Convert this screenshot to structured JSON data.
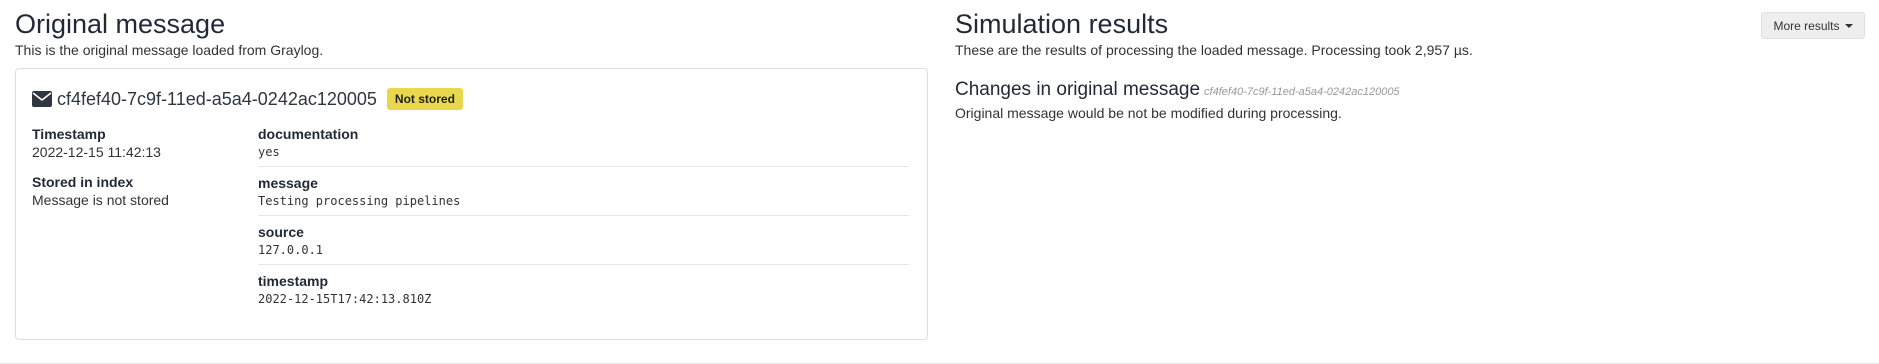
{
  "original": {
    "title": "Original message",
    "subtitle": "This is the original message loaded from Graylog.",
    "message_id": "cf4fef40-7c9f-11ed-a5a4-0242ac120005",
    "badge": "Not stored",
    "meta": [
      {
        "term": "Timestamp",
        "value": "2022-12-15 11:42:13"
      },
      {
        "term": "Stored in index",
        "value": "Message is not stored"
      }
    ],
    "fields": [
      {
        "name": "documentation",
        "value": "yes"
      },
      {
        "name": "message",
        "value": "Testing processing pipelines"
      },
      {
        "name": "source",
        "value": "127.0.0.1"
      },
      {
        "name": "timestamp",
        "value": "2022-12-15T17:42:13.810Z"
      }
    ]
  },
  "simulation": {
    "title": "Simulation results",
    "subtitle": "These are the results of processing the loaded message. Processing took 2,957 µs.",
    "more_button": "More results",
    "changes_title": "Changes in original message",
    "changes_id": "cf4fef40-7c9f-11ed-a5a4-0242ac120005",
    "changes_text": "Original message would be not be modified during processing."
  },
  "colors": {
    "badge": "#e9d84d",
    "border": "#dddddd"
  }
}
